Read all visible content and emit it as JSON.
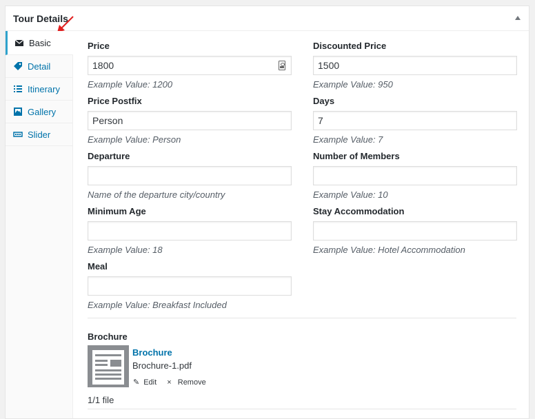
{
  "box": {
    "title": "Tour Details"
  },
  "tabs": [
    {
      "label": "Basic",
      "icon": "envelope-icon"
    },
    {
      "label": "Detail",
      "icon": "tag-icon"
    },
    {
      "label": "Itinerary",
      "icon": "list-icon"
    },
    {
      "label": "Gallery",
      "icon": "image-icon"
    },
    {
      "label": "Slider",
      "icon": "slider-icon"
    }
  ],
  "fields": {
    "price": {
      "label": "Price",
      "value": "1800",
      "desc": "Example Value: 1200"
    },
    "discounted_price": {
      "label": "Discounted Price",
      "value": "1500",
      "desc": "Example Value: 950"
    },
    "price_postfix": {
      "label": "Price Postfix",
      "value": "Person",
      "desc": "Example Value: Person"
    },
    "days": {
      "label": "Days",
      "value": "7",
      "desc": "Example Value: 7"
    },
    "departure": {
      "label": "Departure",
      "value": "",
      "desc": "Name of the departure city/country"
    },
    "members": {
      "label": "Number of Members",
      "value": "",
      "desc": "Example Value: 10"
    },
    "min_age": {
      "label": "Minimum Age",
      "value": "",
      "desc": "Example Value: 18"
    },
    "stay": {
      "label": "Stay Accommodation",
      "value": "",
      "desc": "Example Value: Hotel Accommodation"
    },
    "meal": {
      "label": "Meal",
      "value": "",
      "desc": "Example Value: Breakfast Included"
    }
  },
  "brochure": {
    "label": "Brochure",
    "link": "Brochure",
    "filename": "Brochure-1.pdf",
    "edit": "Edit",
    "remove": "Remove",
    "count": "1/1 file"
  },
  "colors": {
    "accent": "#0073aa",
    "active_tab_border": "#2ea2cc",
    "annotation_arrow": "#e02020"
  }
}
